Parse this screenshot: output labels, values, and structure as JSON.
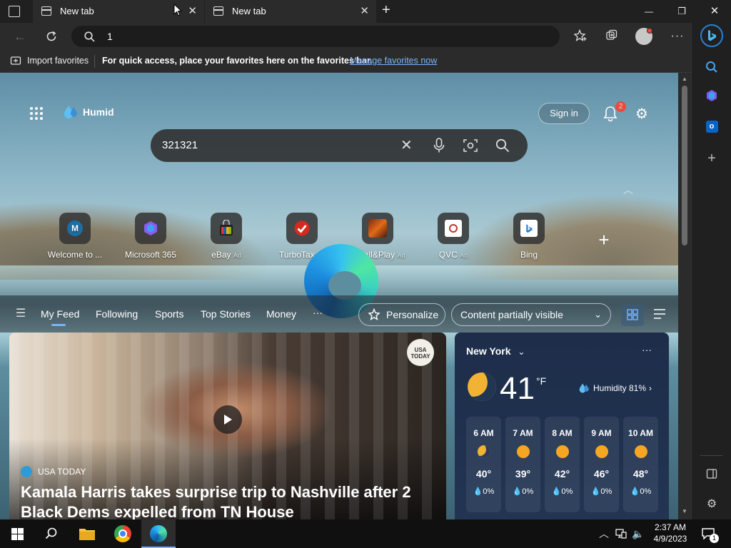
{
  "window": {
    "tabs": [
      {
        "label": "New tab",
        "active": false
      },
      {
        "label": "New tab",
        "active": true
      }
    ],
    "new_tab_symbol": "+",
    "controls": {
      "minimize": "—",
      "restore": "❐",
      "close": "✕"
    }
  },
  "toolbar": {
    "address_value": "1"
  },
  "favorites_bar": {
    "import_label": "Import favorites",
    "message": "For quick access, place your favorites here on the favorites bar.",
    "manage_link": "Manage favorites now"
  },
  "page": {
    "weather_badge": "Humid",
    "sign_in_label": "Sign in",
    "notification_count": "2",
    "search_value": "321321",
    "quick_links": [
      {
        "label": "Welcome to ...",
        "ad": "",
        "icon": "M"
      },
      {
        "label": "Microsoft 365",
        "ad": "",
        "icon": "m365-icon"
      },
      {
        "label": "eBay",
        "ad": "Ad",
        "icon": "ebay-icon"
      },
      {
        "label": "TurboTax",
        "ad": "Ad",
        "icon": "turbotax-icon"
      },
      {
        "label": "Install&Play",
        "ad": "Ad",
        "icon": "installplay-icon"
      },
      {
        "label": "QVC",
        "ad": "Ad",
        "icon": "qvc-icon"
      },
      {
        "label": "Bing",
        "ad": "",
        "icon": "bing-icon"
      }
    ],
    "feed_nav": {
      "items": [
        "My Feed",
        "Following",
        "Sports",
        "Top Stories",
        "Money"
      ],
      "more": "···",
      "personalize_label": "Personalize",
      "content_select": "Content partially visible"
    },
    "news": {
      "source_badge": "USA TODAY",
      "source": "USA TODAY",
      "headline_line1": "Kamala Harris takes surprise trip to Nashville after 2",
      "headline_line2": "Black Dems expelled from TN House"
    },
    "weather": {
      "city": "New York",
      "temp": "41",
      "unit": "°F",
      "humidity": "Humidity 81%",
      "more": "···",
      "hours": [
        {
          "time": "6 AM",
          "temp": "40°",
          "precip": "0%",
          "icon": "moon"
        },
        {
          "time": "7 AM",
          "temp": "39°",
          "precip": "0%",
          "icon": "sun"
        },
        {
          "time": "8 AM",
          "temp": "42°",
          "precip": "0%",
          "icon": "sun"
        },
        {
          "time": "9 AM",
          "temp": "46°",
          "precip": "0%",
          "icon": "sun"
        },
        {
          "time": "10 AM",
          "temp": "48°",
          "precip": "0%",
          "icon": "sun"
        }
      ]
    }
  },
  "taskbar": {
    "time": "2:37 AM",
    "date": "4/9/2023",
    "notification_count": "1"
  },
  "colors": {
    "accent": "#2a80d2",
    "link": "#78b4ff",
    "notification_badge": "#e74c3c"
  }
}
